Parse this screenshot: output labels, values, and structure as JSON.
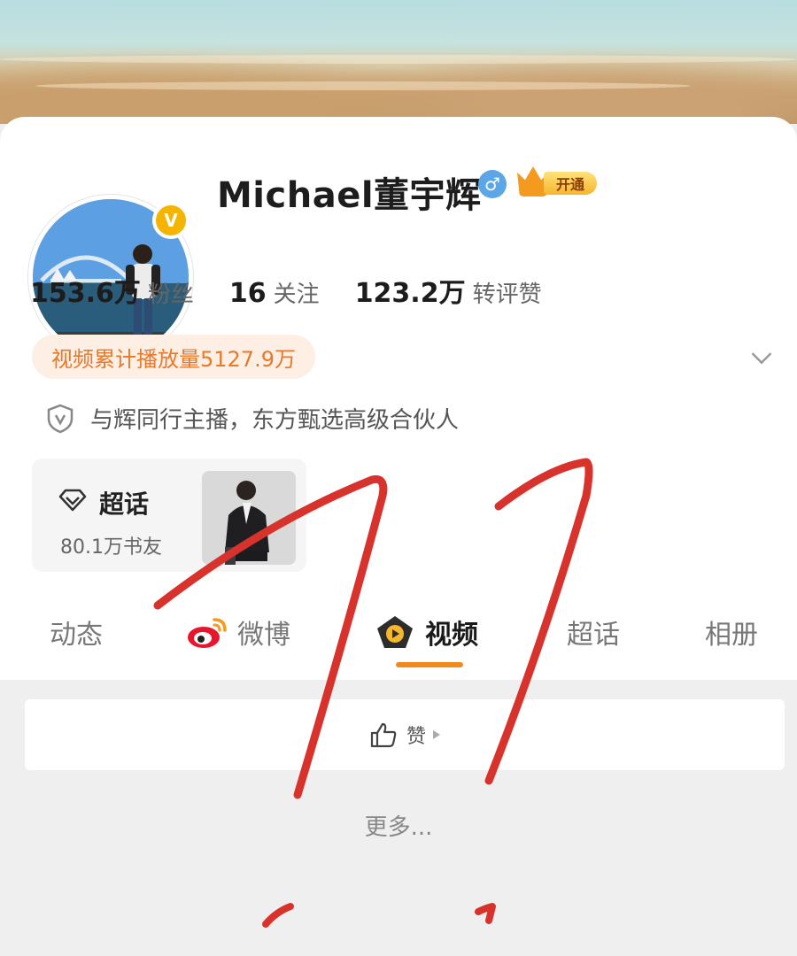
{
  "profile": {
    "name": "Michael董宇辉",
    "verified_badge": "V",
    "gender_icon": "male-icon",
    "vip_label": "开通"
  },
  "stats": [
    {
      "value": "153.6万",
      "label": "粉丝"
    },
    {
      "value": "16",
      "label": "关注"
    },
    {
      "value": "123.2万",
      "label": "转评赞"
    }
  ],
  "video_plays": "视频累计播放量5127.9万",
  "certification": "与辉同行主播，东方甄选高级合伙人",
  "super_topic": {
    "title": "超话",
    "subtitle": "80.1万书友"
  },
  "tabs": [
    {
      "label": "动态"
    },
    {
      "label": "微博"
    },
    {
      "label": "视频",
      "active": true
    },
    {
      "label": "超话"
    },
    {
      "label": "相册"
    }
  ],
  "content": {
    "like_label": "赞",
    "more_label": "更多..."
  },
  "colors": {
    "accent_orange": "#f08a1c",
    "verify_gold": "#f4b400",
    "annotation_red": "#d8322c"
  }
}
